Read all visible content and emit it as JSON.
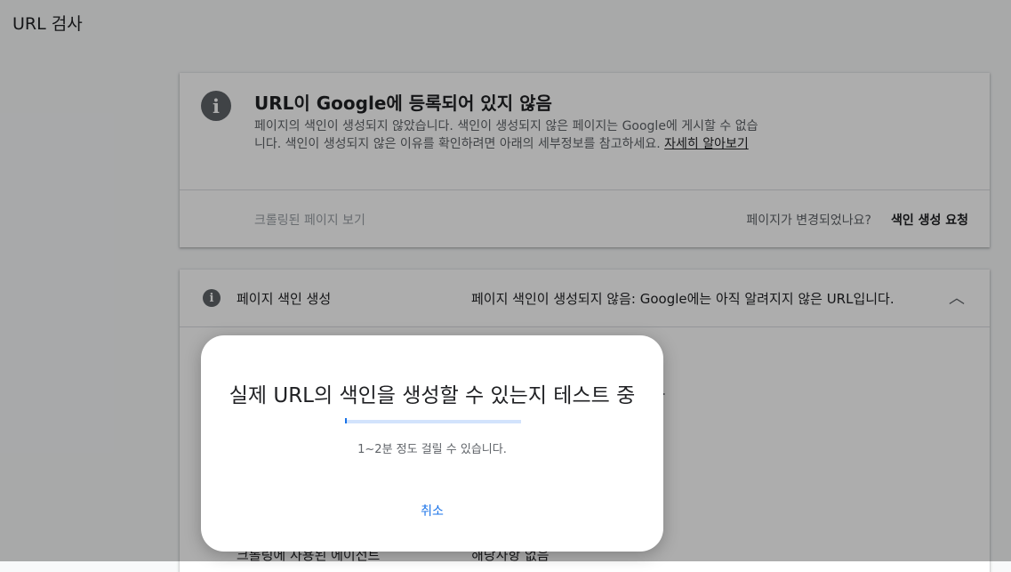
{
  "page": {
    "title": "URL 검사"
  },
  "status_card": {
    "icon": "info-icon",
    "heading": "URL이 Google에 등록되어 있지 않음",
    "description": "페이지의 색인이 생성되지 않았습니다. 색인이 생성되지 않은 페이지는 Google에 게시할 수 없습니다. 색인이 생성되지 않은 이유를 확인하려면 아래의 세부정보를 참고하세요.",
    "learn_more": "자세히 알아보기",
    "crawled_link": "크롤링된 페이지 보기",
    "changed_question": "페이지가 변경되었나요?",
    "request_button": "색인 생성 요청"
  },
  "index_card": {
    "icon": "info-icon",
    "label": "페이지 색인 생성",
    "status": "페이지 색인이 생성되지 않음: Google에는 아직 알려지지 않은 URL입니다.",
    "chevron": "chevron-up-icon",
    "partial_text": ".",
    "row_label": "크롤링에 사용된 에이전트",
    "row_value": "해당사항 없음"
  },
  "dialog": {
    "title": "실제 URL의 색인을 생성할 수 있는지 테스트 중",
    "progress": 0.01,
    "subtitle": "1~2분 정도 걸릴 수 있습니다.",
    "cancel_label": "취소"
  },
  "colors": {
    "accent": "#1a73e8",
    "progress_track": "#d2e3fc",
    "icon_gray": "#5f6368"
  }
}
